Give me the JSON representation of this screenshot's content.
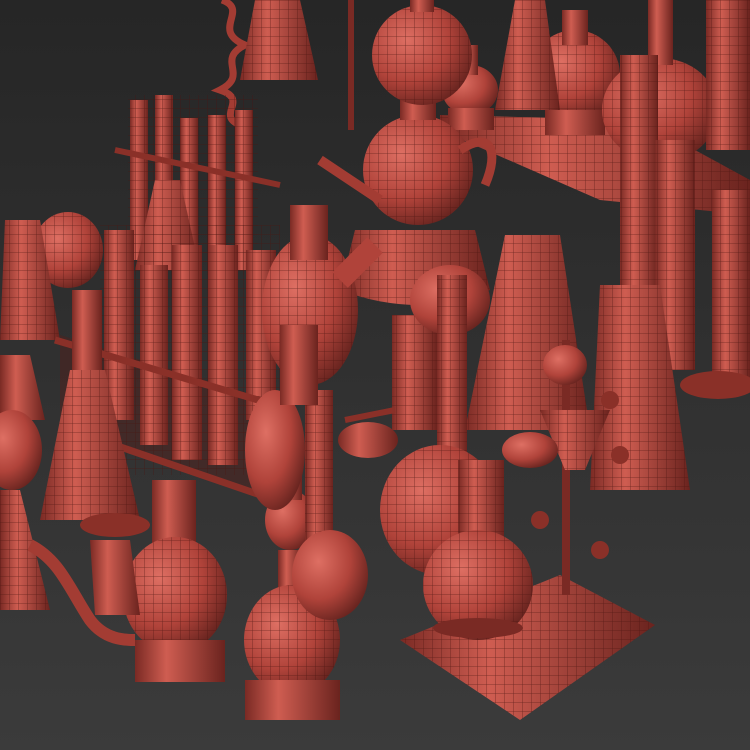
{
  "colors": {
    "background_top": "#2b2b2b",
    "background_bottom": "#3a3a3a",
    "glass_fill": "#b8453a",
    "glass_highlight": "#d8655a",
    "glass_shadow": "#6e2620",
    "wire": "#4a1410"
  }
}
